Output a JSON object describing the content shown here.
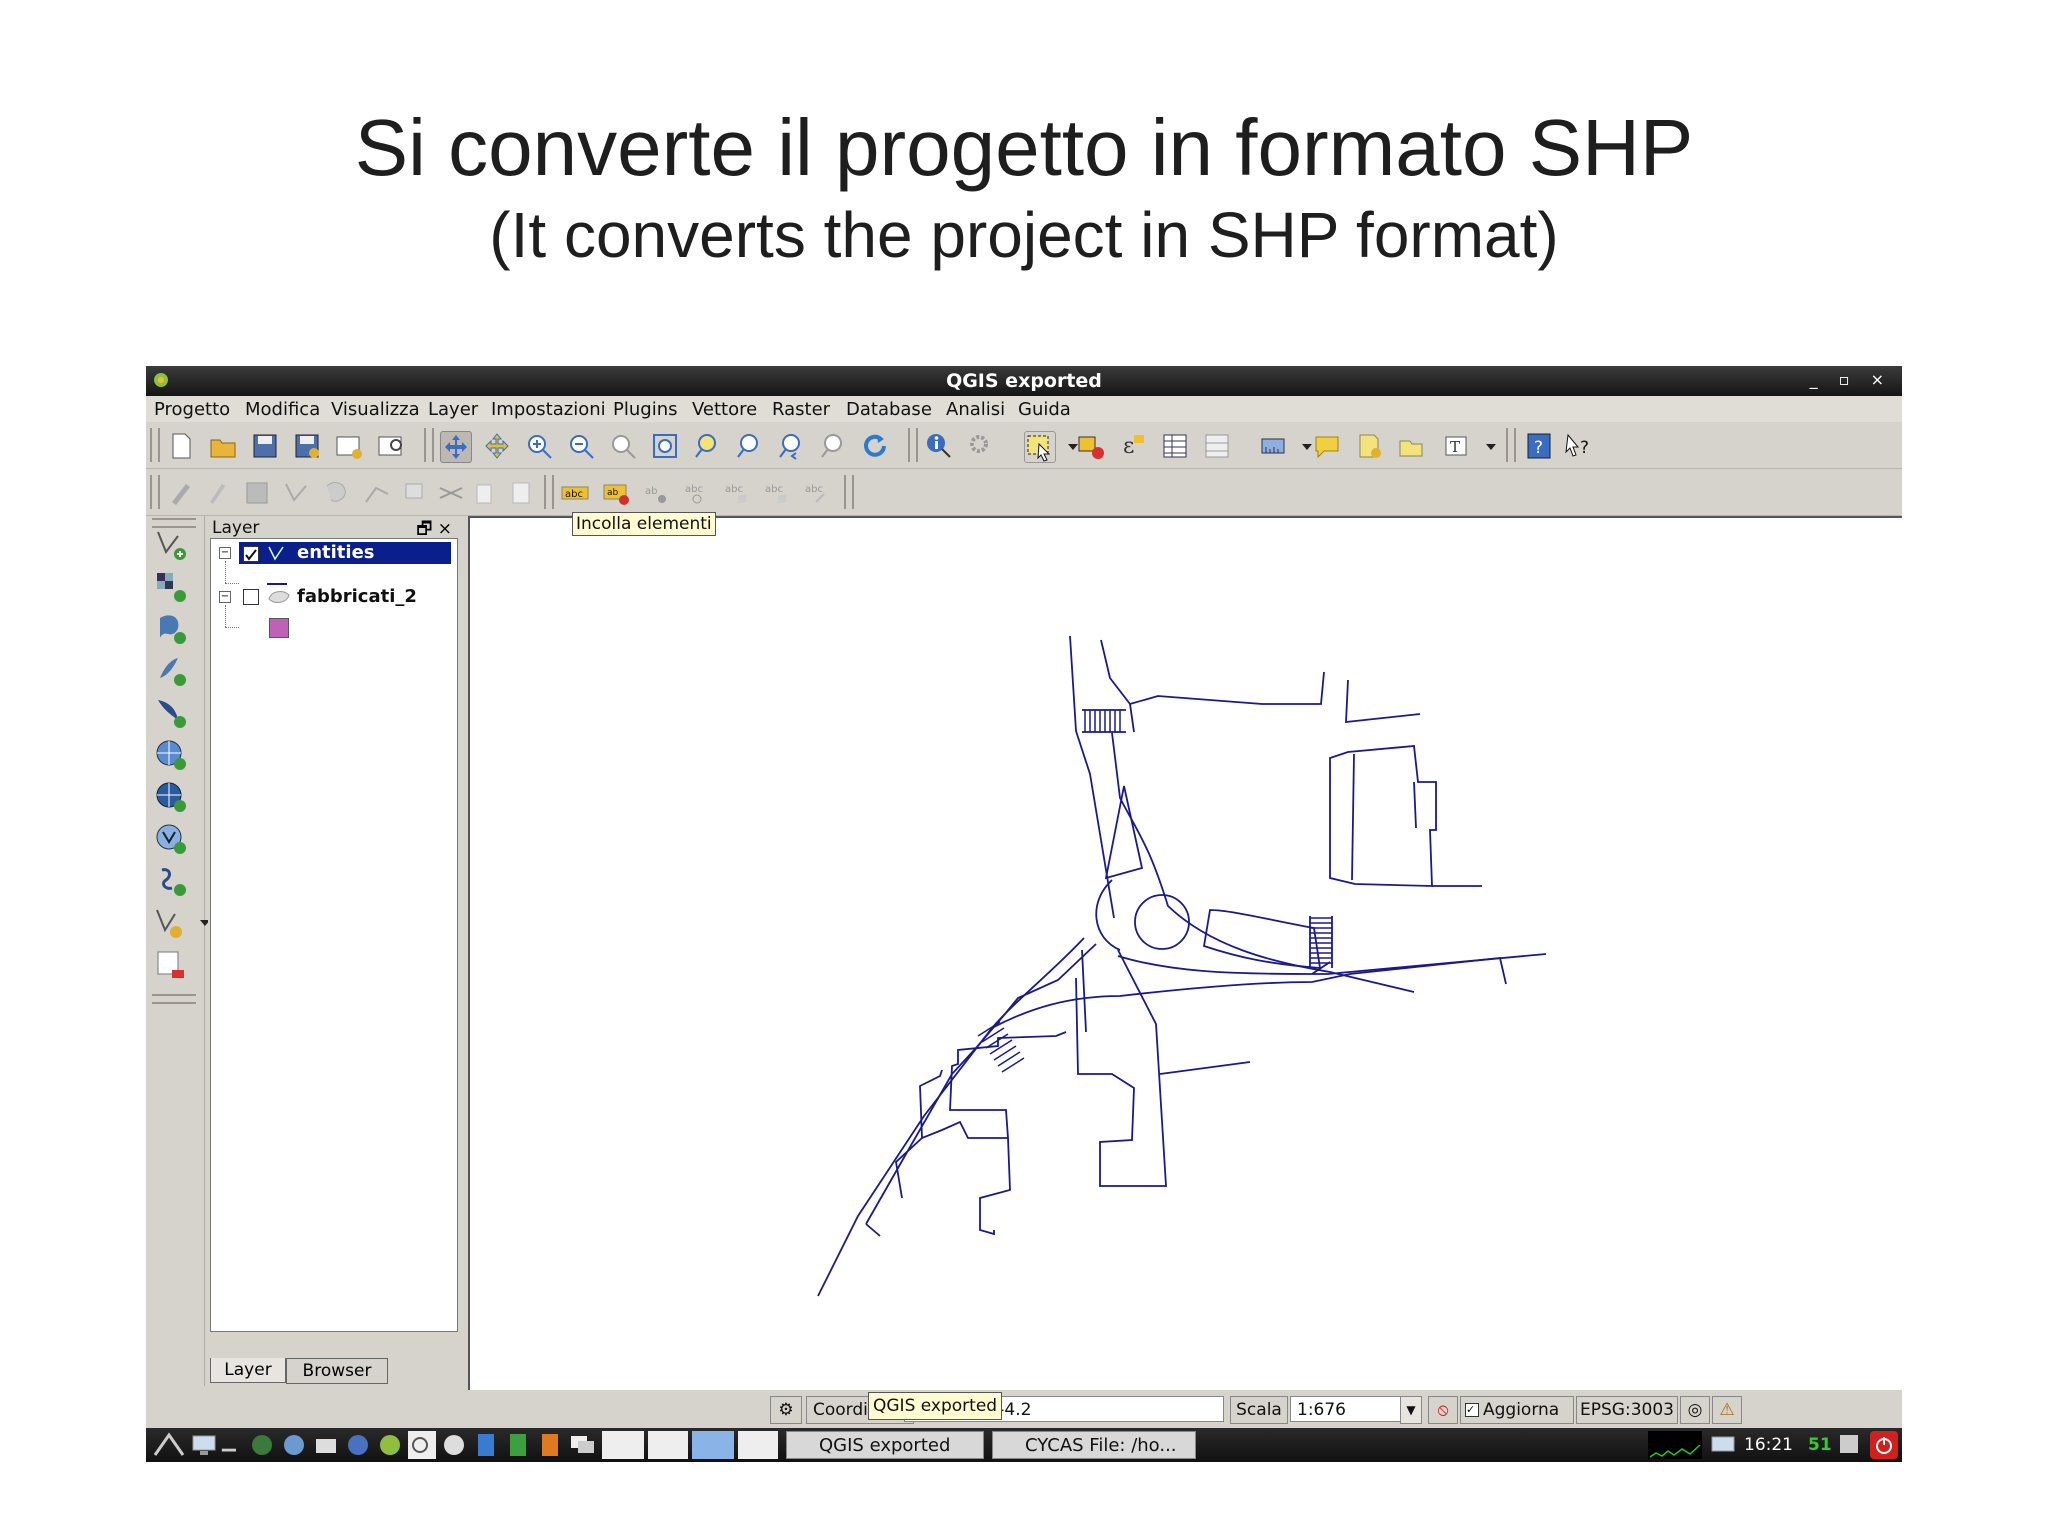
{
  "slide": {
    "title": "Si converte il progetto in formato SHP",
    "subtitle": "(It converts the project in SHP format)"
  },
  "window": {
    "title": "QGIS exported",
    "controls": "_ ▫ ×"
  },
  "menu": [
    "Progetto",
    "Modifica",
    "Visualizza",
    "Layer",
    "Impostazioni",
    "Plugins",
    "Vettore",
    "Raster",
    "Database",
    "Analisi",
    "Guida"
  ],
  "tooltip": "Incolla elementi",
  "layer_panel": {
    "title": "Layer",
    "controls": "🗗 ×",
    "layers": [
      {
        "name": "entities",
        "checked": true,
        "selected": true
      },
      {
        "name": "fabbricati_2",
        "checked": false,
        "selected": false
      }
    ],
    "tabs": [
      "Layer",
      "Browser"
    ]
  },
  "status": {
    "coord_label": "Coordinat",
    "coord_tooltip": "QGIS exported",
    "coord_value": "32.4,-4.2",
    "scale_label": "Scala",
    "scale_value": "1:676",
    "render_label": "Aggiorna",
    "crs": "EPSG:3003"
  },
  "taskbar": {
    "tasks": [
      "QGIS exported",
      "CYCAS  File: /ho..."
    ],
    "clock": "16:21",
    "clock_extra": "51"
  },
  "colors": {
    "map_lines": "#1a1a8c",
    "selection": "#0a1e8c",
    "polygon_symbol": "#c060b8"
  }
}
